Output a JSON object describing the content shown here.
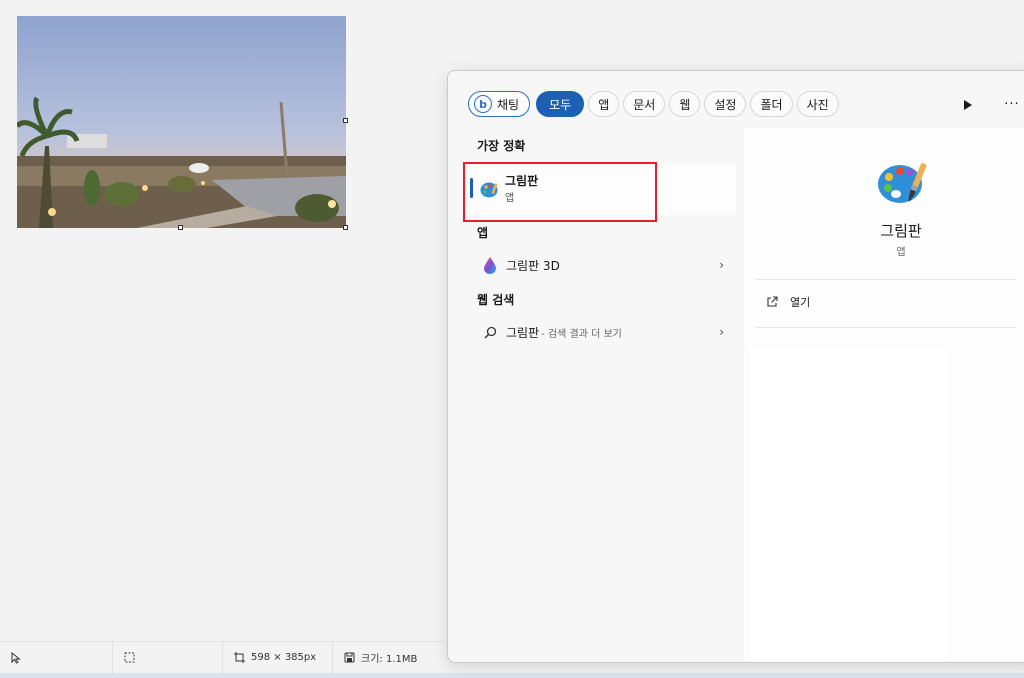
{
  "paint": {
    "statusbar": {
      "pointer_icon": "pointer-icon",
      "selection_icon": "selection-icon",
      "dimensions": "598 × 385px",
      "size_label": "크기: 1.1MB"
    }
  },
  "search": {
    "tabs": {
      "chat": "채팅",
      "all": "모두",
      "apps": "앱",
      "documents": "문서",
      "web": "웹",
      "settings": "설정",
      "folders": "폴더",
      "photos": "사진"
    },
    "more_label": "···",
    "best_match": {
      "header": "가장 정확",
      "name": "그림판",
      "type": "앱"
    },
    "apps": {
      "header": "앱",
      "items": [
        {
          "label": "그림판 3D"
        }
      ]
    },
    "web_search": {
      "header": "웹 검색",
      "query": "그림판",
      "suffix": "- 검색 결과 더 보기"
    },
    "detail": {
      "title": "그림판",
      "subtitle": "앱",
      "open_label": "열기"
    }
  },
  "colors": {
    "accent": "#1c5fb4",
    "highlight": "#e0202a"
  }
}
